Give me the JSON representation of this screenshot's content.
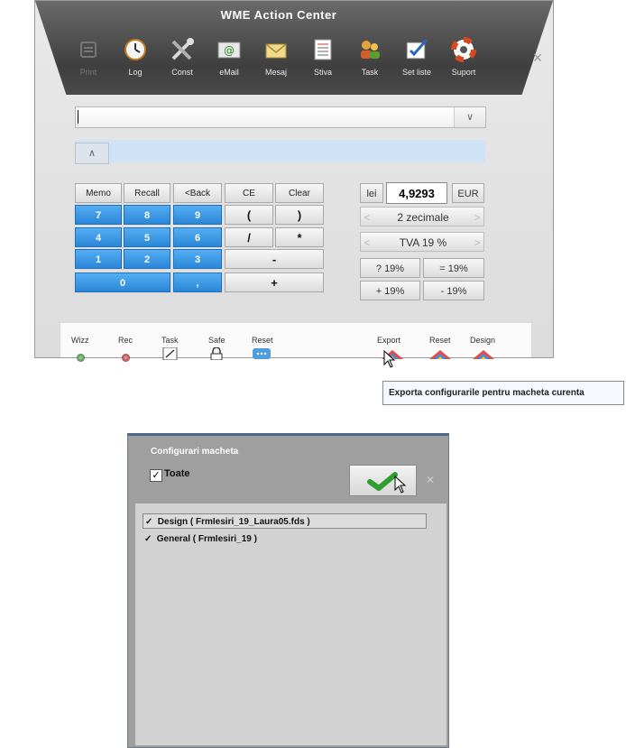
{
  "window": {
    "title": "WME Action Center",
    "close_icon": "close-icon"
  },
  "toolbar": [
    {
      "label": "Print",
      "icon": "printer-icon",
      "disabled": true
    },
    {
      "label": "Log",
      "icon": "clock-icon"
    },
    {
      "label": "Const",
      "icon": "tools-icon"
    },
    {
      "label": "eMail",
      "icon": "email-icon"
    },
    {
      "label": "Mesaj",
      "icon": "envelope-icon"
    },
    {
      "label": "Stiva",
      "icon": "list-icon"
    },
    {
      "label": "Task",
      "icon": "users-icon"
    },
    {
      "label": "Set liste",
      "icon": "checklist-icon"
    },
    {
      "label": "Suport",
      "icon": "lifebuoy-icon"
    }
  ],
  "input": {
    "value": "",
    "dropdown_icon": "chevron-down-icon"
  },
  "collapse_icon": "chevron-up-icon",
  "keypad": {
    "memo": "Memo",
    "recall": "Recall",
    "back": "<Back",
    "ce": "CE",
    "clear": "Clear",
    "k7": "7",
    "k8": "8",
    "k9": "9",
    "lparen": "(",
    "rparen": ")",
    "k4": "4",
    "k5": "5",
    "k6": "6",
    "div": "/",
    "mul": "*",
    "k1": "1",
    "k2": "2",
    "k3": "3",
    "minus": "-",
    "k0": "0",
    "dot": ",",
    "plus": "+"
  },
  "currency": {
    "from": "lei",
    "rate": "4,9293",
    "to": "EUR",
    "decimals": "2 zecimale",
    "vat": "TVA 19 %",
    "vat_q": "? 19%",
    "vat_eq": "= 19%",
    "vat_plus": "+ 19%",
    "vat_minus": "- 19%"
  },
  "bottom": {
    "wizz": "Wizz",
    "rec": "Rec",
    "task": "Task",
    "safe": "Safe",
    "reset": "Reset",
    "export": "Export",
    "reset2": "Reset",
    "design": "Design"
  },
  "tooltip": "Exporta configurarile pentru macheta curenta",
  "dialog": {
    "title": "Configurari macheta",
    "all_label": "Toate",
    "ok_icon": "checkmark-icon",
    "items": [
      "Design ( FrmIesiri_19_Laura05.fds )",
      "General ( FrmIesiri_19 )"
    ]
  },
  "colors": {
    "keypad_blue": "#2a86d8",
    "header_dark": "#4a4a4a",
    "list_bg": "#d2d2d2",
    "dialog_bg": "#9f9f9f"
  }
}
